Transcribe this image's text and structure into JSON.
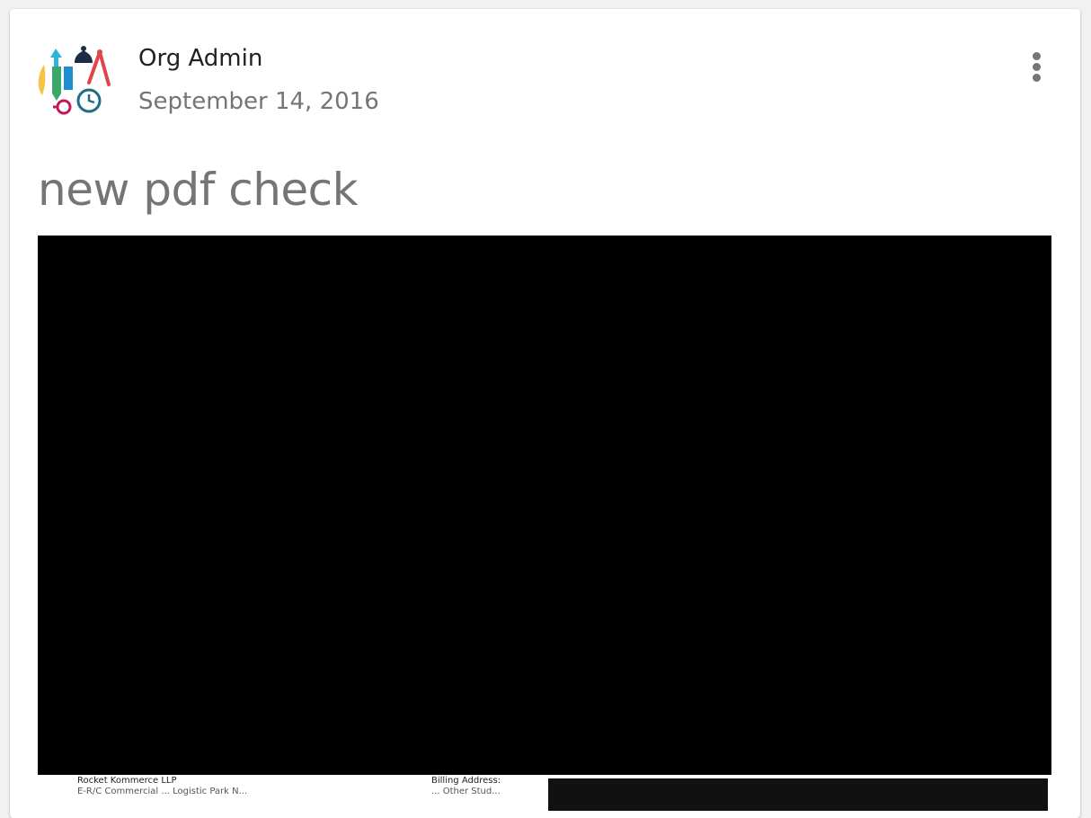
{
  "post": {
    "author": "Org Admin",
    "date": "September 14, 2016",
    "title": "new pdf check",
    "menu_icon": "more-vert-icon",
    "avatar_icon": "stationery-logo-icon"
  },
  "pdf_preview": {
    "seller_name": "Rocket Kommerce LLP",
    "seller_address_partial": "E-R/C Commercial ... Logistic Park N...",
    "billing_label": "Billing Address:",
    "billing_partial": "... Other Stud..."
  },
  "colors": {
    "title": "#757575",
    "author": "#212121",
    "date": "#757575",
    "preview_bg": "#000000"
  }
}
